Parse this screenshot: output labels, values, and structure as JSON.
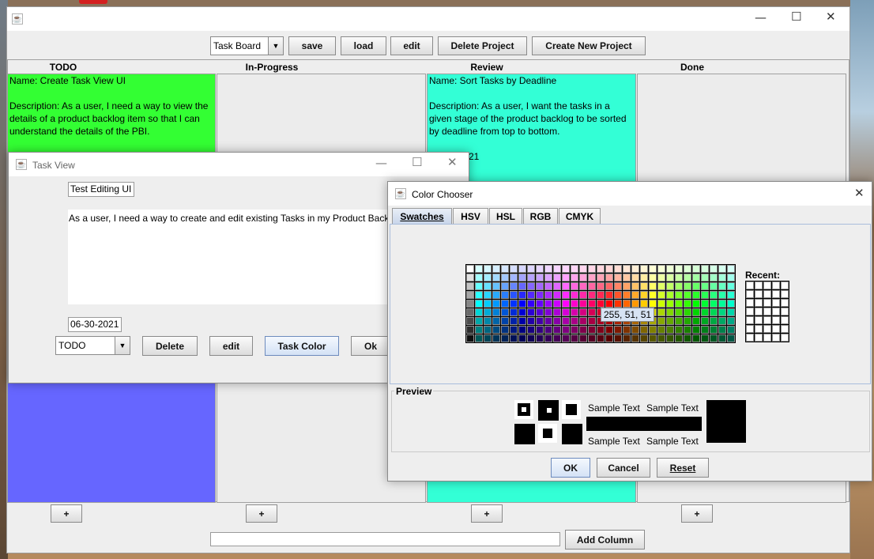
{
  "main": {
    "toolbar": {
      "board_select": "Task Board",
      "save": "save",
      "load": "load",
      "edit": "edit",
      "delete_project": "Delete Project",
      "create_project": "Create New Project"
    },
    "columns": [
      {
        "header": "TODO",
        "add": "+"
      },
      {
        "header": "In-Progress",
        "add": "+"
      },
      {
        "header": "Review",
        "add": "+"
      },
      {
        "header": "Done",
        "add": "+"
      }
    ],
    "cards": {
      "todo": {
        "name": "Name: Create Task View UI",
        "description": "Description: As a user, I need a way to view the details of a product backlog item so that I can understand the details of the PBI.",
        "color": "#33ff33",
        "lower_color": "#6666ff"
      },
      "review": {
        "name": "Name: Sort Tasks by Deadline",
        "description": "Description: As a user, I want the tasks in a given stage of the product backlog to be sorted by deadline from top to bottom.",
        "partial_line": "21",
        "color": "#33ffd6"
      }
    },
    "bottom": {
      "column_name_value": "",
      "add_column": "Add Column"
    }
  },
  "task_view": {
    "title": "Task View",
    "name_value": "Test Editing UI",
    "description_value": "As a user, I need a way to create and edit existing Tasks in my Product Backlog",
    "date_value": "06-30-2021",
    "stage_select": "TODO",
    "delete": "Delete",
    "edit": "edit",
    "task_color": "Task Color",
    "ok": "Ok"
  },
  "color_chooser": {
    "title": "Color Chooser",
    "tabs": [
      {
        "label": "Swatches",
        "active": true
      },
      {
        "label": "HSV"
      },
      {
        "label": "HSL"
      },
      {
        "label": "RGB"
      },
      {
        "label": "CMYK"
      }
    ],
    "recent_label": "Recent:",
    "tooltip": "255, 51, 51",
    "preview_label": "Preview",
    "sample_text": "Sample Text",
    "ok": "OK",
    "cancel": "Cancel",
    "reset": "Reset"
  }
}
